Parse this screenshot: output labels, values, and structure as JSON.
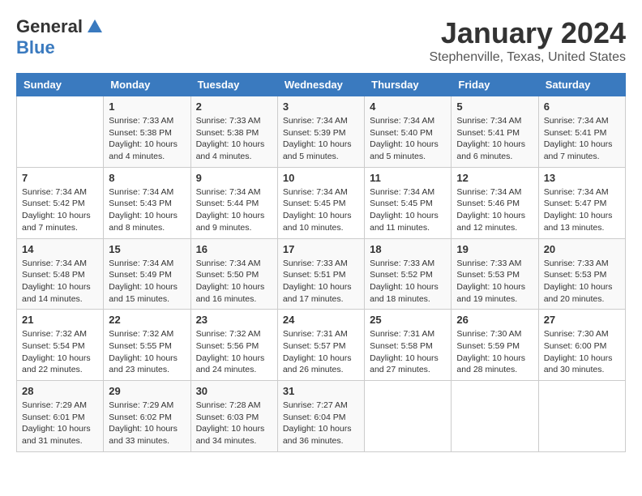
{
  "logo": {
    "general": "General",
    "blue": "Blue"
  },
  "title": "January 2024",
  "subtitle": "Stephenville, Texas, United States",
  "headers": [
    "Sunday",
    "Monday",
    "Tuesday",
    "Wednesday",
    "Thursday",
    "Friday",
    "Saturday"
  ],
  "weeks": [
    [
      {
        "day": "",
        "info": ""
      },
      {
        "day": "1",
        "info": "Sunrise: 7:33 AM\nSunset: 5:38 PM\nDaylight: 10 hours and 4 minutes."
      },
      {
        "day": "2",
        "info": "Sunrise: 7:33 AM\nSunset: 5:38 PM\nDaylight: 10 hours and 4 minutes."
      },
      {
        "day": "3",
        "info": "Sunrise: 7:34 AM\nSunset: 5:39 PM\nDaylight: 10 hours and 5 minutes."
      },
      {
        "day": "4",
        "info": "Sunrise: 7:34 AM\nSunset: 5:40 PM\nDaylight: 10 hours and 5 minutes."
      },
      {
        "day": "5",
        "info": "Sunrise: 7:34 AM\nSunset: 5:41 PM\nDaylight: 10 hours and 6 minutes."
      },
      {
        "day": "6",
        "info": "Sunrise: 7:34 AM\nSunset: 5:41 PM\nDaylight: 10 hours and 7 minutes."
      }
    ],
    [
      {
        "day": "7",
        "info": "Sunrise: 7:34 AM\nSunset: 5:42 PM\nDaylight: 10 hours and 7 minutes."
      },
      {
        "day": "8",
        "info": "Sunrise: 7:34 AM\nSunset: 5:43 PM\nDaylight: 10 hours and 8 minutes."
      },
      {
        "day": "9",
        "info": "Sunrise: 7:34 AM\nSunset: 5:44 PM\nDaylight: 10 hours and 9 minutes."
      },
      {
        "day": "10",
        "info": "Sunrise: 7:34 AM\nSunset: 5:45 PM\nDaylight: 10 hours and 10 minutes."
      },
      {
        "day": "11",
        "info": "Sunrise: 7:34 AM\nSunset: 5:45 PM\nDaylight: 10 hours and 11 minutes."
      },
      {
        "day": "12",
        "info": "Sunrise: 7:34 AM\nSunset: 5:46 PM\nDaylight: 10 hours and 12 minutes."
      },
      {
        "day": "13",
        "info": "Sunrise: 7:34 AM\nSunset: 5:47 PM\nDaylight: 10 hours and 13 minutes."
      }
    ],
    [
      {
        "day": "14",
        "info": "Sunrise: 7:34 AM\nSunset: 5:48 PM\nDaylight: 10 hours and 14 minutes."
      },
      {
        "day": "15",
        "info": "Sunrise: 7:34 AM\nSunset: 5:49 PM\nDaylight: 10 hours and 15 minutes."
      },
      {
        "day": "16",
        "info": "Sunrise: 7:34 AM\nSunset: 5:50 PM\nDaylight: 10 hours and 16 minutes."
      },
      {
        "day": "17",
        "info": "Sunrise: 7:33 AM\nSunset: 5:51 PM\nDaylight: 10 hours and 17 minutes."
      },
      {
        "day": "18",
        "info": "Sunrise: 7:33 AM\nSunset: 5:52 PM\nDaylight: 10 hours and 18 minutes."
      },
      {
        "day": "19",
        "info": "Sunrise: 7:33 AM\nSunset: 5:53 PM\nDaylight: 10 hours and 19 minutes."
      },
      {
        "day": "20",
        "info": "Sunrise: 7:33 AM\nSunset: 5:53 PM\nDaylight: 10 hours and 20 minutes."
      }
    ],
    [
      {
        "day": "21",
        "info": "Sunrise: 7:32 AM\nSunset: 5:54 PM\nDaylight: 10 hours and 22 minutes."
      },
      {
        "day": "22",
        "info": "Sunrise: 7:32 AM\nSunset: 5:55 PM\nDaylight: 10 hours and 23 minutes."
      },
      {
        "day": "23",
        "info": "Sunrise: 7:32 AM\nSunset: 5:56 PM\nDaylight: 10 hours and 24 minutes."
      },
      {
        "day": "24",
        "info": "Sunrise: 7:31 AM\nSunset: 5:57 PM\nDaylight: 10 hours and 26 minutes."
      },
      {
        "day": "25",
        "info": "Sunrise: 7:31 AM\nSunset: 5:58 PM\nDaylight: 10 hours and 27 minutes."
      },
      {
        "day": "26",
        "info": "Sunrise: 7:30 AM\nSunset: 5:59 PM\nDaylight: 10 hours and 28 minutes."
      },
      {
        "day": "27",
        "info": "Sunrise: 7:30 AM\nSunset: 6:00 PM\nDaylight: 10 hours and 30 minutes."
      }
    ],
    [
      {
        "day": "28",
        "info": "Sunrise: 7:29 AM\nSunset: 6:01 PM\nDaylight: 10 hours and 31 minutes."
      },
      {
        "day": "29",
        "info": "Sunrise: 7:29 AM\nSunset: 6:02 PM\nDaylight: 10 hours and 33 minutes."
      },
      {
        "day": "30",
        "info": "Sunrise: 7:28 AM\nSunset: 6:03 PM\nDaylight: 10 hours and 34 minutes."
      },
      {
        "day": "31",
        "info": "Sunrise: 7:27 AM\nSunset: 6:04 PM\nDaylight: 10 hours and 36 minutes."
      },
      {
        "day": "",
        "info": ""
      },
      {
        "day": "",
        "info": ""
      },
      {
        "day": "",
        "info": ""
      }
    ]
  ]
}
